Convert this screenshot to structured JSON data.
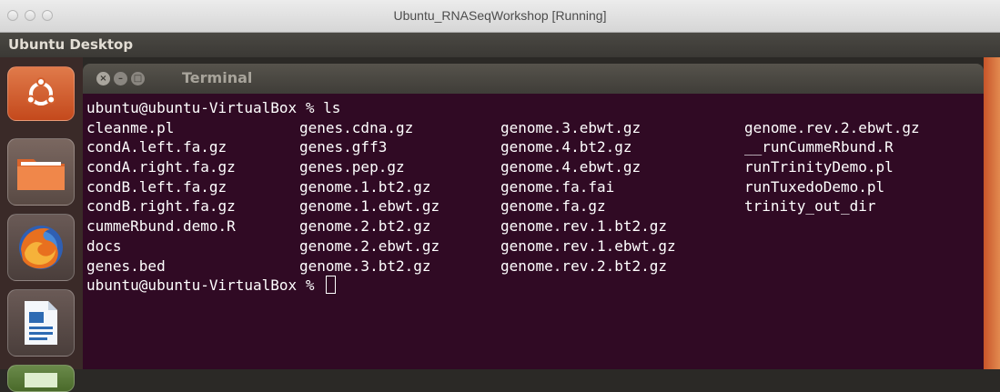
{
  "window": {
    "title": "Ubuntu_RNASeqWorkshop [Running]"
  },
  "panel": {
    "title": "Ubuntu Desktop"
  },
  "launcher": {
    "items": [
      {
        "name": "dash-home",
        "icon": "ubuntu-logo-icon"
      },
      {
        "name": "files",
        "icon": "folder-icon"
      },
      {
        "name": "firefox",
        "icon": "firefox-icon"
      },
      {
        "name": "libreoffice-writer",
        "icon": "writer-document-icon"
      },
      {
        "name": "calc",
        "icon": "spreadsheet-icon"
      }
    ]
  },
  "terminal": {
    "title": "Terminal",
    "prompt": "ubuntu@ubuntu-VirtualBox % ",
    "command": "ls",
    "listing": [
      [
        "cleanme.pl",
        "genes.cdna.gz",
        "genome.3.ebwt.gz",
        "genome.rev.2.ebwt.gz"
      ],
      [
        "condA.left.fa.gz",
        "genes.gff3",
        "genome.4.bt2.gz",
        "__runCummeRbund.R"
      ],
      [
        "condA.right.fa.gz",
        "genes.pep.gz",
        "genome.4.ebwt.gz",
        "runTrinityDemo.pl"
      ],
      [
        "condB.left.fa.gz",
        "genome.1.bt2.gz",
        "genome.fa.fai",
        "runTuxedoDemo.pl"
      ],
      [
        "condB.right.fa.gz",
        "genome.1.ebwt.gz",
        "genome.fa.gz",
        "trinity_out_dir"
      ],
      [
        "cummeRbund.demo.R",
        "genome.2.bt2.gz",
        "genome.rev.1.bt2.gz",
        ""
      ],
      [
        "docs",
        "genome.2.ebwt.gz",
        "genome.rev.1.ebwt.gz",
        ""
      ],
      [
        "genes.bed",
        "genome.3.bt2.gz",
        "genome.rev.2.bt2.gz",
        ""
      ]
    ]
  },
  "colors": {
    "terminal_bg": "#300a24",
    "panel_bg": "#3c3b37",
    "launcher_bg": "#3a2a28"
  }
}
